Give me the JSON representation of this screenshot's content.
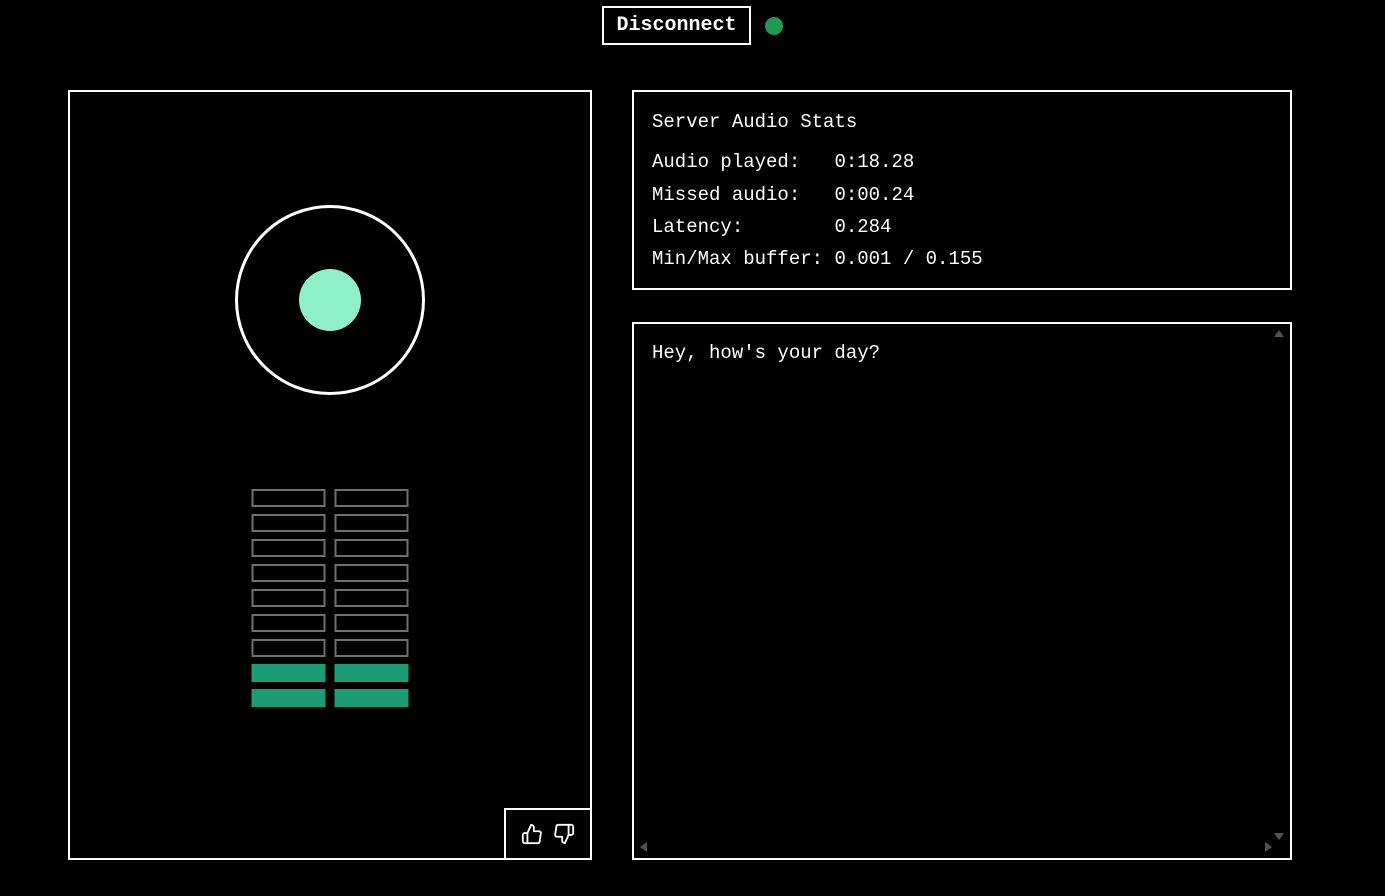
{
  "header": {
    "disconnect_label": "Disconnect",
    "status_color": "#1e9a52"
  },
  "visualizer": {
    "orb_core_color": "#8ef0c8",
    "meter_rows": 9,
    "meter_cols": 2,
    "lit_rows_from_bottom": 2
  },
  "stats": {
    "title": "Server Audio Stats",
    "rows": [
      {
        "label": "Audio played:",
        "value": "0:18.28"
      },
      {
        "label": "Missed audio:",
        "value": "0:00.24"
      },
      {
        "label": "Latency:",
        "value": "0.284"
      },
      {
        "label": "Min/Max buffer:",
        "value": "0.001 / 0.155"
      }
    ]
  },
  "transcript": {
    "text": "Hey, how's your day?"
  }
}
